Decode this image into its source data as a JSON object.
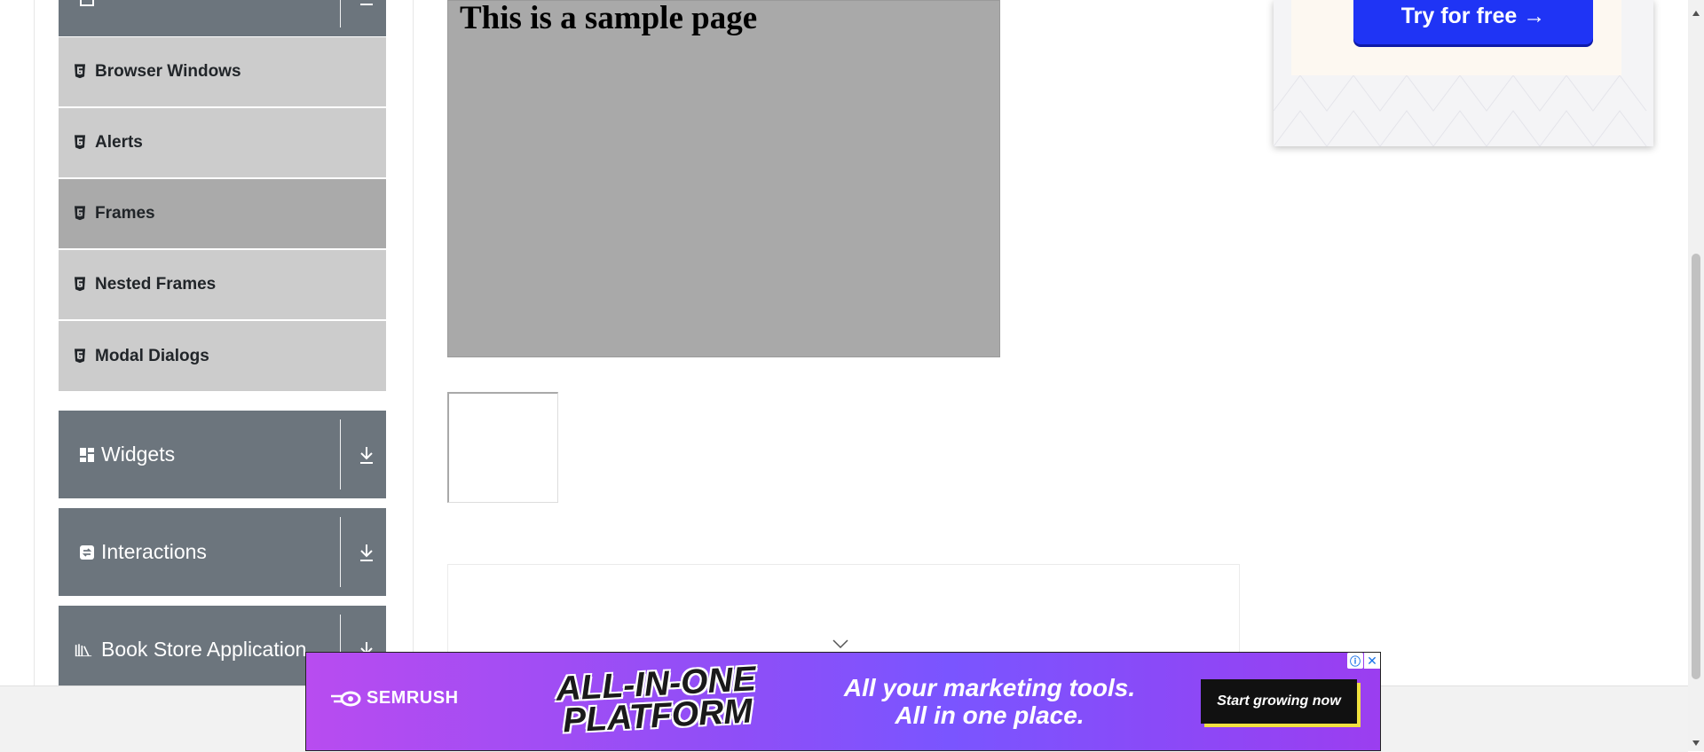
{
  "sidebar": {
    "top_group": {
      "icon": "form-icon"
    },
    "items": [
      {
        "label": "Browser Windows",
        "icon": "html5-icon"
      },
      {
        "label": "Alerts",
        "icon": "html5-icon"
      },
      {
        "label": "Frames",
        "icon": "html5-icon",
        "active": true
      },
      {
        "label": "Nested Frames",
        "icon": "html5-icon"
      },
      {
        "label": "Modal Dialogs",
        "icon": "html5-icon"
      }
    ],
    "groups": [
      {
        "label": "Widgets",
        "icon": "widgets-icon"
      },
      {
        "label": "Interactions",
        "icon": "interactions-icon"
      },
      {
        "label": "Book Store Application",
        "icon": "book-icon"
      }
    ]
  },
  "main": {
    "frame_heading": "This is a sample page"
  },
  "right_ad": {
    "button_label": "Try for free →"
  },
  "banner_ad": {
    "brand": "SEMRUSH",
    "headline_line1": "ALL-IN-ONE",
    "headline_line2": "PLATFORM",
    "tagline_line1": "All your marketing tools.",
    "tagline_line2": "All in one place.",
    "cta": "Start growing now",
    "adchoices": "ⓘ",
    "close": "✕"
  },
  "colors": {
    "sidebar_header": "#6c757d",
    "menu_item": "#cccccc",
    "menu_item_active": "#aaaaaa",
    "frame_bg": "#a9a9a9",
    "try_button": "#1f34f5"
  }
}
